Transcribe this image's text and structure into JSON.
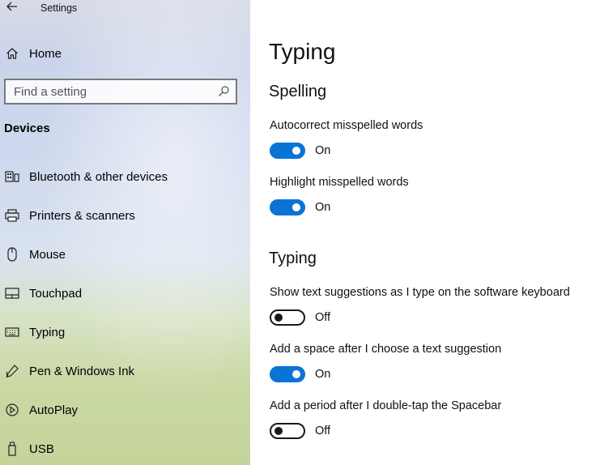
{
  "window": {
    "title": "Settings"
  },
  "sidebar": {
    "home_label": "Home",
    "search": {
      "placeholder": "Find a setting"
    },
    "section": "Devices",
    "items": [
      {
        "label": "Bluetooth & other devices",
        "icon": "bluetooth-devices-icon"
      },
      {
        "label": "Printers & scanners",
        "icon": "printer-icon"
      },
      {
        "label": "Mouse",
        "icon": "mouse-icon"
      },
      {
        "label": "Touchpad",
        "icon": "touchpad-icon"
      },
      {
        "label": "Typing",
        "icon": "keyboard-icon"
      },
      {
        "label": "Pen & Windows Ink",
        "icon": "pen-icon"
      },
      {
        "label": "AutoPlay",
        "icon": "autoplay-icon"
      },
      {
        "label": "USB",
        "icon": "usb-icon"
      }
    ]
  },
  "main": {
    "title": "Typing",
    "groups": [
      {
        "title": "Spelling",
        "settings": [
          {
            "label": "Autocorrect misspelled words",
            "state": "On"
          },
          {
            "label": "Highlight misspelled words",
            "state": "On"
          }
        ]
      },
      {
        "title": "Typing",
        "settings": [
          {
            "label": "Show text suggestions as I type on the software keyboard",
            "state": "Off"
          },
          {
            "label": "Add a space after I choose a text suggestion",
            "state": "On"
          },
          {
            "label": "Add a period after I double-tap the Spacebar",
            "state": "Off"
          }
        ]
      }
    ]
  },
  "colors": {
    "accent": "#0a74d6",
    "toggle_off_border": "#1a1a1a"
  }
}
